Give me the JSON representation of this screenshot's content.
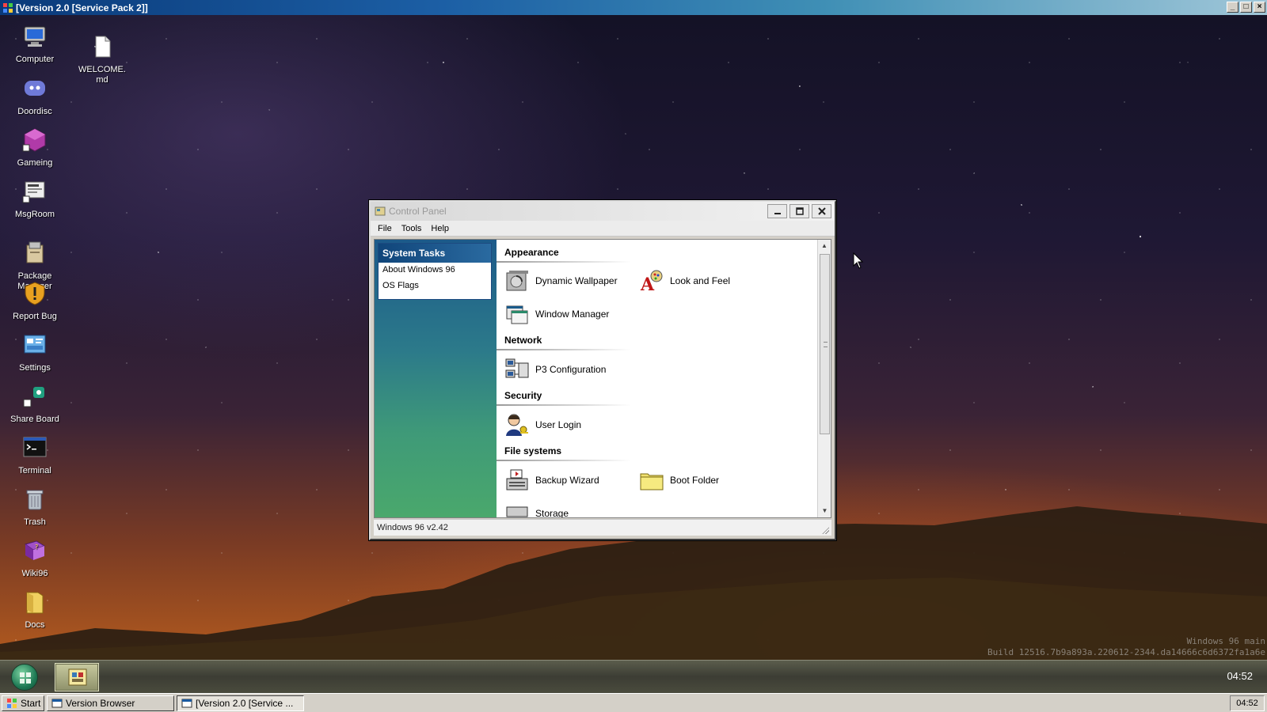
{
  "host": {
    "title": "[Version 2.0 [Service Pack 2]]",
    "taskbar": {
      "start_label": "Start",
      "buttons": [
        "Version Browser",
        "[Version 2.0 [Service ..."
      ],
      "clock": "04:52"
    },
    "window_controls": [
      "_",
      "□",
      "×"
    ]
  },
  "desktop": {
    "icons": [
      {
        "label": "Computer",
        "icon": "computer-icon"
      },
      {
        "label": "WELCOME.\nmd",
        "icon": "document-icon"
      },
      {
        "label": "Doordisc",
        "icon": "chat-icon"
      },
      {
        "label": "Gameing",
        "icon": "game-icon"
      },
      {
        "label": "MsgRoom",
        "icon": "message-room-icon"
      },
      {
        "label": "Package\nManager",
        "icon": "package-icon"
      },
      {
        "label": "Report Bug",
        "icon": "shield-icon"
      },
      {
        "label": "Settings",
        "icon": "settings-icon"
      },
      {
        "label": "Share Board",
        "icon": "share-icon"
      },
      {
        "label": "Terminal",
        "icon": "terminal-icon"
      },
      {
        "label": "Trash",
        "icon": "trash-icon"
      },
      {
        "label": "Wiki96",
        "icon": "book-icon"
      },
      {
        "label": "Docs",
        "icon": "folder-icon"
      }
    ],
    "watermark": [
      "Windows 96 main",
      "Build 12516.7b9a893a.220612-2344.da14666c6d6372fa1a6e"
    ],
    "dock_clock": "04:52"
  },
  "control_panel": {
    "title": "Control Panel",
    "menu": [
      "File",
      "Tools",
      "Help"
    ],
    "system_tasks": {
      "header": "System Tasks",
      "links": [
        "About Windows 96",
        "OS Flags"
      ]
    },
    "sections": {
      "appearance": {
        "title": "Appearance",
        "items": [
          "Dynamic Wallpaper",
          "Look and Feel",
          "Window Manager"
        ]
      },
      "network": {
        "title": "Network",
        "items": [
          "P3 Configuration"
        ]
      },
      "security": {
        "title": "Security",
        "items": [
          "User Login"
        ]
      },
      "file_systems": {
        "title": "File systems",
        "items": [
          "Backup Wizard",
          "Boot Folder",
          "Storage"
        ]
      }
    },
    "status": "Windows 96 v2.42"
  },
  "colors": {
    "accent": "#10457a",
    "sidebar_top": "#1c5a8a",
    "sidebar_bottom": "#4aa86c"
  }
}
